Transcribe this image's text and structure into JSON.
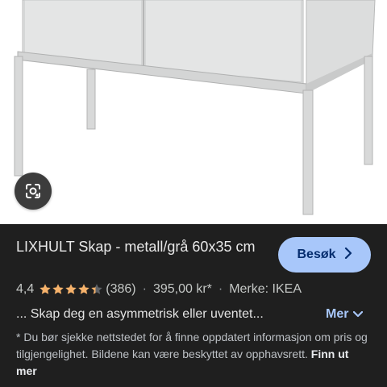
{
  "product": {
    "title": "LIXHULT Skap - metall/grå 60x35 cm",
    "rating": "4,4",
    "rating_value": 4.4,
    "rating_max": 5,
    "review_count": "(386)",
    "price": "395,00 kr*",
    "brand": "Merke: IKEA",
    "snippet": "... Skap deg en asymmetrisk eller uventet..."
  },
  "actions": {
    "visit_label": "Besøk",
    "more_label": "Mer"
  },
  "disclaimer": {
    "text": "* Du bør sjekke nettstedet for å finne oppdatert informasjon om pris og tilgjengelighet. Bildene kan være beskyttet av opphavsrett.",
    "link_label": "Finn ut mer"
  },
  "icons": {
    "lens": "google-lens-icon",
    "visit_chevron": "chevron-right-icon",
    "more_chevron": "chevron-down-icon",
    "star": "star-icon"
  },
  "colors": {
    "panel_bg": "#1f1f1f",
    "accent": "#a8c7fa",
    "star": "#f6b26b",
    "cabinet": "#e6e7e7"
  }
}
